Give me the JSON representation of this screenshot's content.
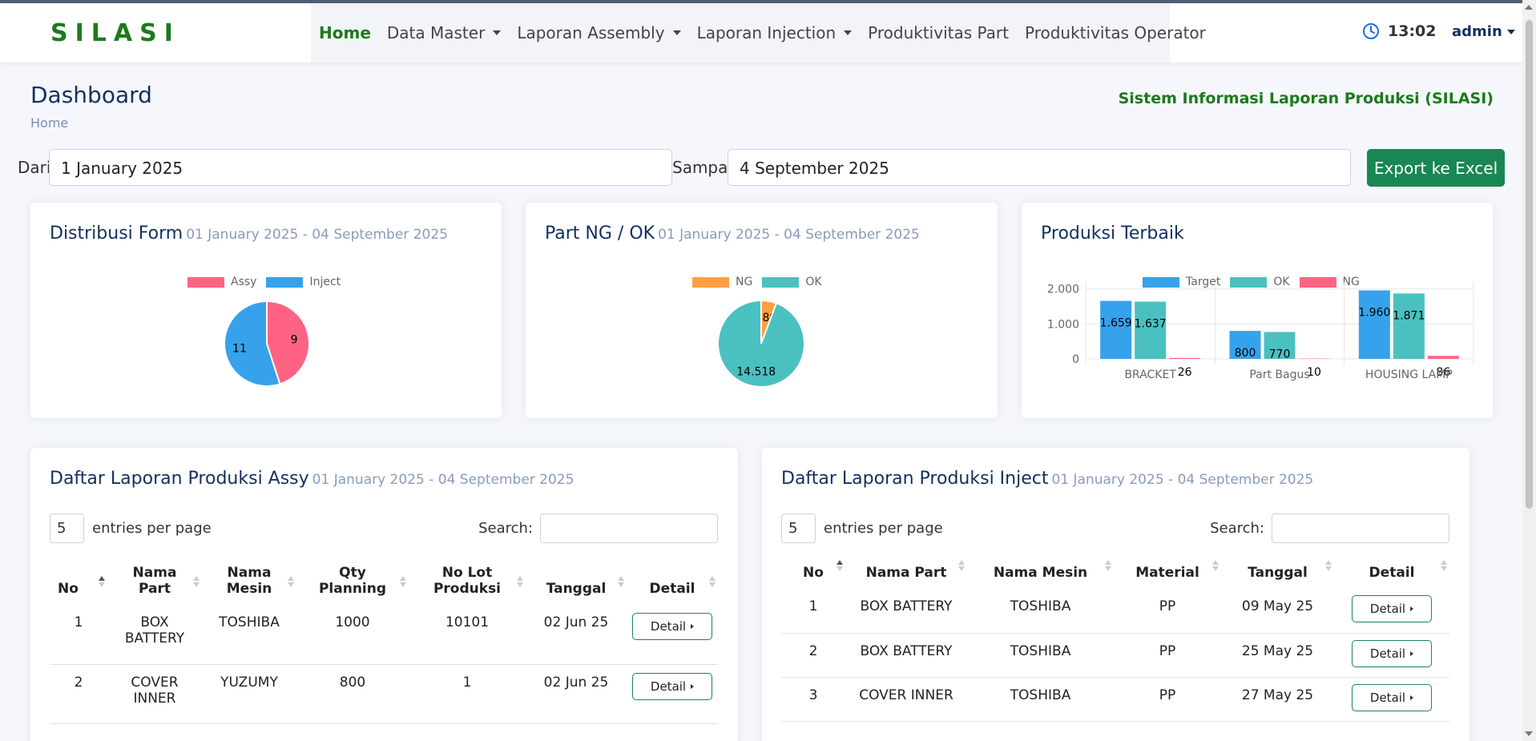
{
  "brand": "SILASI",
  "nav": {
    "items": [
      {
        "label": "Home",
        "active": true,
        "dropdown": false
      },
      {
        "label": "Data Master",
        "dropdown": true
      },
      {
        "label": "Laporan Assembly",
        "dropdown": true
      },
      {
        "label": "Laporan Injection",
        "dropdown": true
      },
      {
        "label": "Produktivitas Part",
        "dropdown": false
      },
      {
        "label": "Produktivitas Operator",
        "dropdown": false
      }
    ],
    "clock": "13:02",
    "user": "admin"
  },
  "page": {
    "title": "Dashboard",
    "breadcrumb": "Home",
    "system_title": "Sistem Informasi Laporan Produksi (SILASI)"
  },
  "filter": {
    "from_label": "Dari",
    "from_value": "1 January 2025",
    "to_label": "Sampai",
    "to_value": "4 September 2025",
    "export_label": "Export ke Excel"
  },
  "colors": {
    "brand_green": "#1c7a1c",
    "navy": "#12305e",
    "assy": "#ff6384",
    "inject": "#36a2eb",
    "ng_orange": "#ff9f40",
    "ok_teal": "#4bc0c0",
    "target": "#36a2eb",
    "ng_pink": "#ff6384"
  },
  "cards": {
    "distribusi": {
      "title": "Distribusi Form",
      "subtitle": "01 January 2025 - 04 September 2025"
    },
    "partng": {
      "title": "Part NG / OK",
      "subtitle": "01 January 2025 - 04 September 2025"
    },
    "terbaik": {
      "title": "Produksi Terbaik"
    }
  },
  "chart_data": [
    {
      "type": "pie",
      "labels": [
        "Assy",
        "Inject"
      ],
      "values": [
        9,
        11
      ],
      "legend_position": "top"
    },
    {
      "type": "pie",
      "labels": [
        "NG",
        "OK"
      ],
      "values": [
        880,
        14518
      ],
      "value_labels": [
        "880",
        "14.518"
      ],
      "legend_position": "top"
    },
    {
      "type": "bar",
      "categories": [
        "BRACKET",
        "Part Bagus",
        "HOUSING LAMP"
      ],
      "series": [
        {
          "name": "Target",
          "values": [
            1659,
            800,
            1960
          ],
          "labels": [
            "1.659",
            "800",
            "1.960"
          ]
        },
        {
          "name": "OK",
          "values": [
            1637,
            770,
            1871
          ],
          "labels": [
            "1.637",
            "770",
            "1.871"
          ]
        },
        {
          "name": "NG",
          "values": [
            26,
            10,
            86
          ],
          "labels": [
            "26",
            "10",
            "86"
          ]
        }
      ],
      "y_ticks": [
        "2.000",
        "1.000",
        "0"
      ],
      "ylim": [
        0,
        2200
      ],
      "grid": true,
      "legend_position": "top"
    }
  ],
  "assy_table": {
    "title": "Daftar Laporan Produksi Assy",
    "subtitle": "01 January 2025 - 04 September 2025",
    "per_page": "5",
    "per_page_label": "entries per page",
    "search_label": "Search:",
    "headers": [
      "No",
      "Nama Part",
      "Nama Mesin",
      "Qty Planning",
      "No Lot Produksi",
      "Tanggal",
      "Detail"
    ],
    "rows": [
      {
        "no": "1",
        "part": "BOX BATTERY",
        "mesin": "TOSHIBA",
        "qty": "1000",
        "lot": "10101",
        "tanggal": "02 Jun 25",
        "detail": "Detail"
      },
      {
        "no": "2",
        "part": "COVER INNER",
        "mesin": "YUZUMY",
        "qty": "800",
        "lot": "1",
        "tanggal": "02 Jun 25",
        "detail": "Detail"
      }
    ]
  },
  "inject_table": {
    "title": "Daftar Laporan Produksi Inject",
    "subtitle": "01 January 2025 - 04 September 2025",
    "per_page": "5",
    "per_page_label": "entries per page",
    "search_label": "Search:",
    "headers": [
      "No",
      "Nama Part",
      "Nama Mesin",
      "Material",
      "Tanggal",
      "Detail"
    ],
    "rows": [
      {
        "no": "1",
        "part": "BOX BATTERY",
        "mesin": "TOSHIBA",
        "material": "PP",
        "tanggal": "09 May 25",
        "detail": "Detail"
      },
      {
        "no": "2",
        "part": "BOX BATTERY",
        "mesin": "TOSHIBA",
        "material": "PP",
        "tanggal": "25 May 25",
        "detail": "Detail"
      },
      {
        "no": "3",
        "part": "COVER INNER",
        "mesin": "TOSHIBA",
        "material": "PP",
        "tanggal": "27 May 25",
        "detail": "Detail"
      }
    ]
  }
}
